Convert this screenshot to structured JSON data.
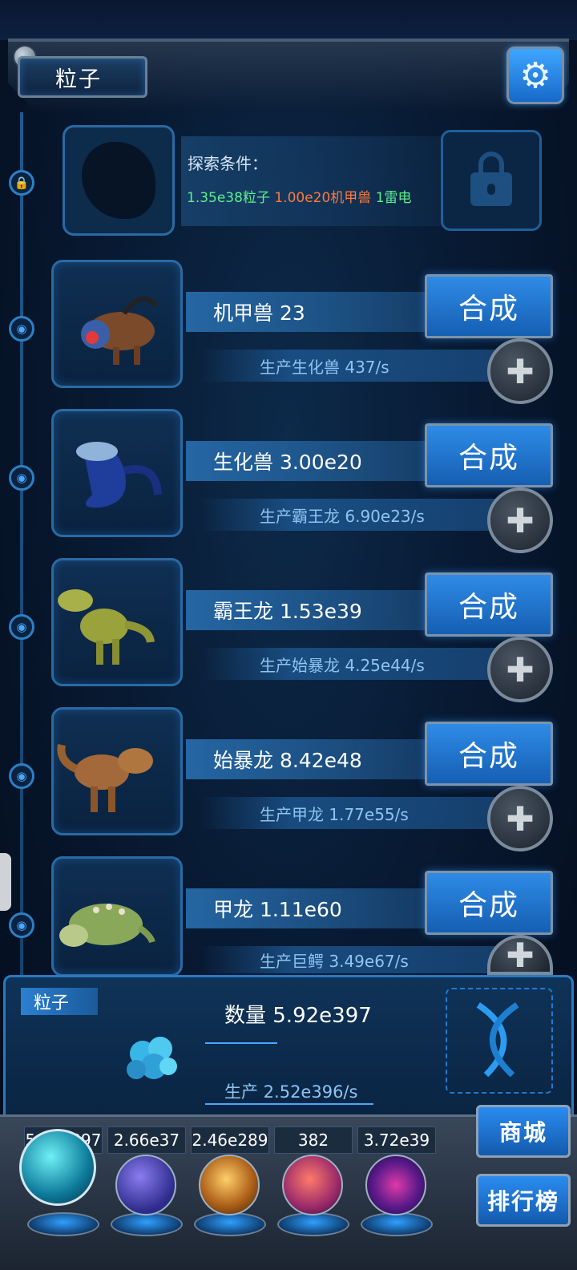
{
  "header": {
    "title": "粒子",
    "settings_icon": "gear-icon"
  },
  "explore": {
    "label": "探索条件：",
    "req_a": "1.35e38粒子",
    "req_b": "1.00e20机甲兽",
    "req_c": "1雷电",
    "lock_icon": "lock-icon"
  },
  "creatures": [
    {
      "name": "机甲兽 23",
      "production": "生产生化兽 437/s",
      "craft_label": "合成"
    },
    {
      "name": "生化兽 3.00e20",
      "production": "生产霸王龙 6.90e23/s",
      "craft_label": "合成"
    },
    {
      "name": "霸王龙 1.53e39",
      "production": "生产始暴龙 4.25e44/s",
      "craft_label": "合成"
    },
    {
      "name": "始暴龙 8.42e48",
      "production": "生产甲龙 1.77e55/s",
      "craft_label": "合成"
    },
    {
      "name": "甲龙 1.11e60",
      "production": "生产巨鳄 3.49e67/s",
      "craft_label": "合成"
    }
  ],
  "resource": {
    "tag": "粒子",
    "quantity": "数量 5.92e397",
    "production": "生产 2.52e396/s"
  },
  "toolbar": {
    "counts": [
      "5.92e397",
      "2.66e37",
      "2.46e289",
      "382",
      "3.72e39"
    ],
    "shop_label": "商城",
    "rank_label": "排行榜"
  },
  "colors": {
    "accent": "#2f8be6",
    "req_green": "#5ef08c",
    "req_orange": "#ff7a3a"
  }
}
